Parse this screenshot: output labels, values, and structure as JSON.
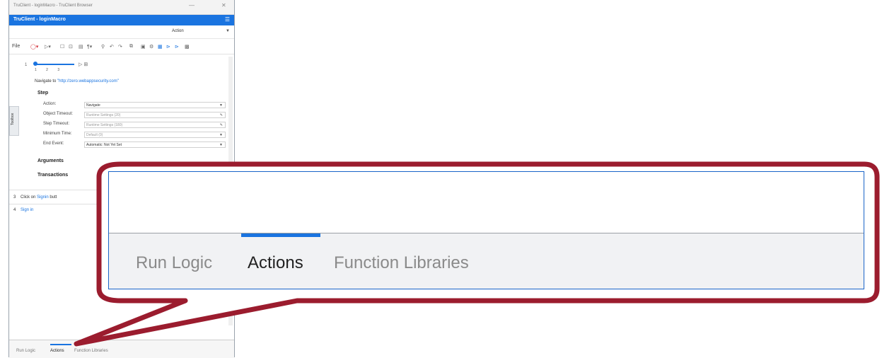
{
  "window": {
    "title": "TruClient - loginMacro - TruClient Browser",
    "header": "TruClient - loginMacro",
    "action_select": "Action"
  },
  "toolbar": {
    "file_label": "File"
  },
  "toolbox_label": "Toolbox",
  "step": {
    "slider_numbers": "1 2 3",
    "row_number": "1",
    "navigate_prefix": "Navigate to",
    "navigate_url": "\"http://zero.webappsecurity.com\"",
    "section_title": "Step",
    "props": [
      {
        "label": "Action:",
        "value": "Navigate"
      },
      {
        "label": "Object Timeout:",
        "value": "Runtime Settings (20)"
      },
      {
        "label": "Step Timeout:",
        "value": "Runtime Settings (180)"
      },
      {
        "label": "Minimum Time:",
        "value": "Default (0)"
      },
      {
        "label": "End Event:",
        "value": "Automatic: Not Yet Set"
      }
    ],
    "arguments": "Arguments",
    "transactions": "Transactions"
  },
  "steps_list": [
    {
      "num": "3",
      "text": "Click on",
      "link": "Signin",
      "suffix": "butt"
    },
    {
      "num": "4",
      "text": "Sign in"
    }
  ],
  "small_tabs": [
    "Run Logic",
    "Actions",
    "Function Libraries"
  ],
  "zoom_tabs": {
    "items": [
      "Run Logic",
      "Actions",
      "Function Libraries"
    ],
    "active": "Actions"
  },
  "colors": {
    "accent": "#1a74e0",
    "callout": "#9b1c2e"
  }
}
